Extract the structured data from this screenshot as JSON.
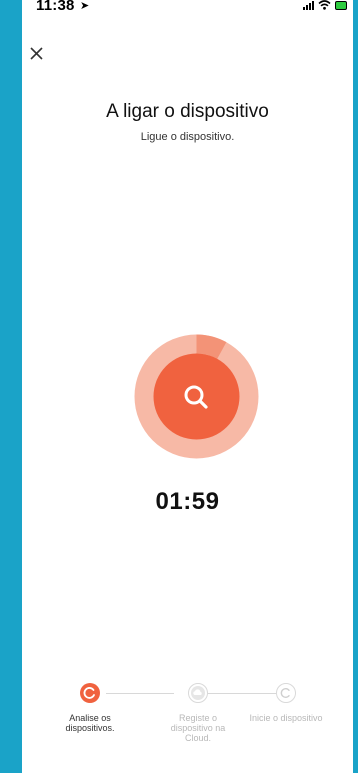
{
  "status_bar": {
    "time": "11:38"
  },
  "header": {
    "title": "A ligar o dispositivo",
    "subtitle": "Ligue o dispositivo."
  },
  "scanner": {
    "icon": "search-icon",
    "progress": 0.08
  },
  "timer": "01:59",
  "steps": [
    {
      "label": "Analise os dispositivos.",
      "icon": "refresh-icon",
      "active": true
    },
    {
      "label": "Registe o dispositivo na Cloud.",
      "icon": "cloud-icon",
      "active": false
    },
    {
      "label": "Inicie o dispositivo",
      "icon": "power-icon",
      "active": false
    }
  ],
  "colors": {
    "accent": "#f0623f",
    "accent_light": "#f7b9a6",
    "accent_mid": "#f39377",
    "border": "#1aa3c8",
    "inactive": "#d9d9d9"
  }
}
